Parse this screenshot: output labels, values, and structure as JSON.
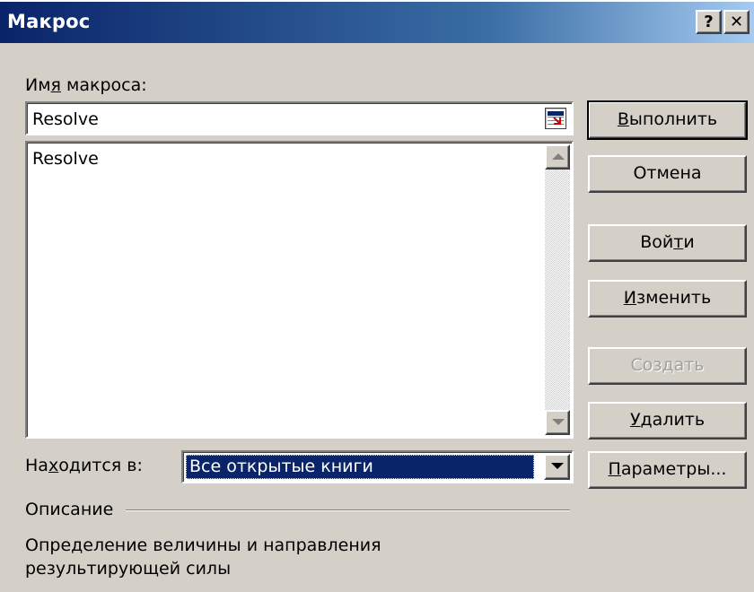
{
  "window": {
    "title": "Макрос",
    "help_label": "?",
    "close_label": "✕"
  },
  "macro_name": {
    "label_pre": "Им",
    "label_acc": "я",
    "label_post": " макроса:",
    "value": "Resolve"
  },
  "macro_list": {
    "items": [
      "Resolve"
    ]
  },
  "location": {
    "label_pre": "На",
    "label_acc": "х",
    "label_post": "одится в:",
    "selected": "Все открытые книги"
  },
  "description": {
    "group_label": "Описание",
    "line1": "Определение величины и направления",
    "line2": "результирующей силы"
  },
  "buttons": {
    "run": {
      "acc": "В",
      "rest": "ыполнить"
    },
    "cancel": {
      "label": "Отмена"
    },
    "step_into": {
      "pre": "Вой",
      "acc": "т",
      "rest": "и"
    },
    "edit": {
      "acc": "И",
      "rest": "зменить"
    },
    "create": {
      "label": "Создать",
      "disabled": true
    },
    "delete": {
      "acc": "У",
      "rest": "далить"
    },
    "options": {
      "acc": "П",
      "rest": "араметры..."
    }
  },
  "colors": {
    "face": "#d4d0c8",
    "title_start": "#0a246a",
    "title_end": "#a6caf0",
    "selection": "#0a246a"
  }
}
